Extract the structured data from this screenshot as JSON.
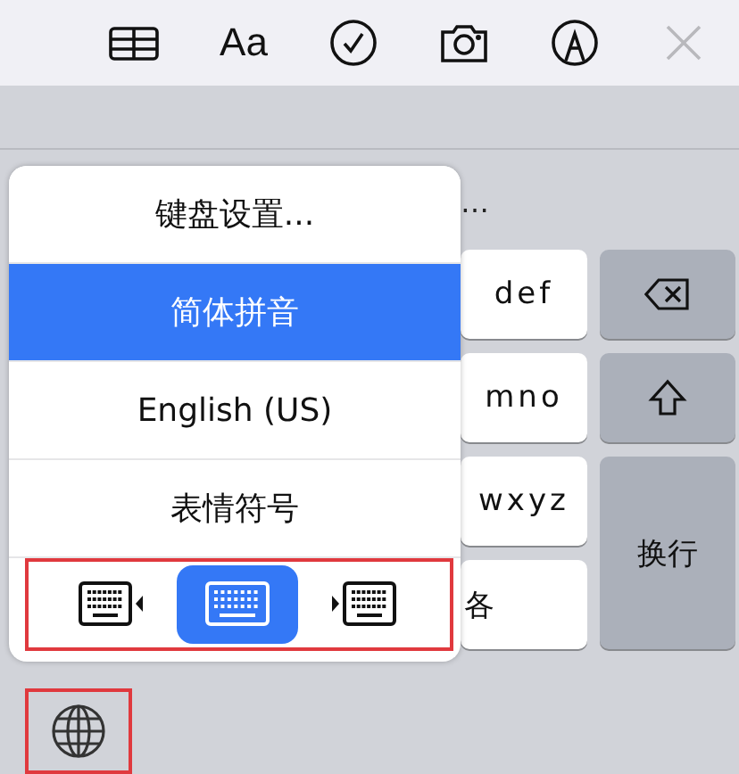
{
  "toolbar": {
    "items": [
      {
        "kind": "table"
      },
      {
        "kind": "text",
        "label": "Aa"
      },
      {
        "kind": "check"
      },
      {
        "kind": "camera"
      },
      {
        "kind": "markup"
      },
      {
        "kind": "close",
        "disabled": true
      }
    ]
  },
  "candidate": "…",
  "letter_keys": [
    "def",
    "mno",
    "wxyz",
    "各"
  ],
  "function_keys": [
    {
      "kind": "delete"
    },
    {
      "kind": "shift"
    },
    {
      "kind": "return",
      "label": "换行"
    }
  ],
  "popup": {
    "items": [
      {
        "label": "键盘设置...",
        "selected": false
      },
      {
        "label": "简体拼音",
        "selected": true
      },
      {
        "label": "English (US)",
        "selected": false
      },
      {
        "label": "表情符号",
        "selected": false
      }
    ],
    "modes_highlighted": true,
    "modes": [
      {
        "kind": "left",
        "selected": false
      },
      {
        "kind": "full",
        "selected": true
      },
      {
        "kind": "right",
        "selected": false
      }
    ]
  },
  "globe_key": {
    "highlighted": true
  }
}
